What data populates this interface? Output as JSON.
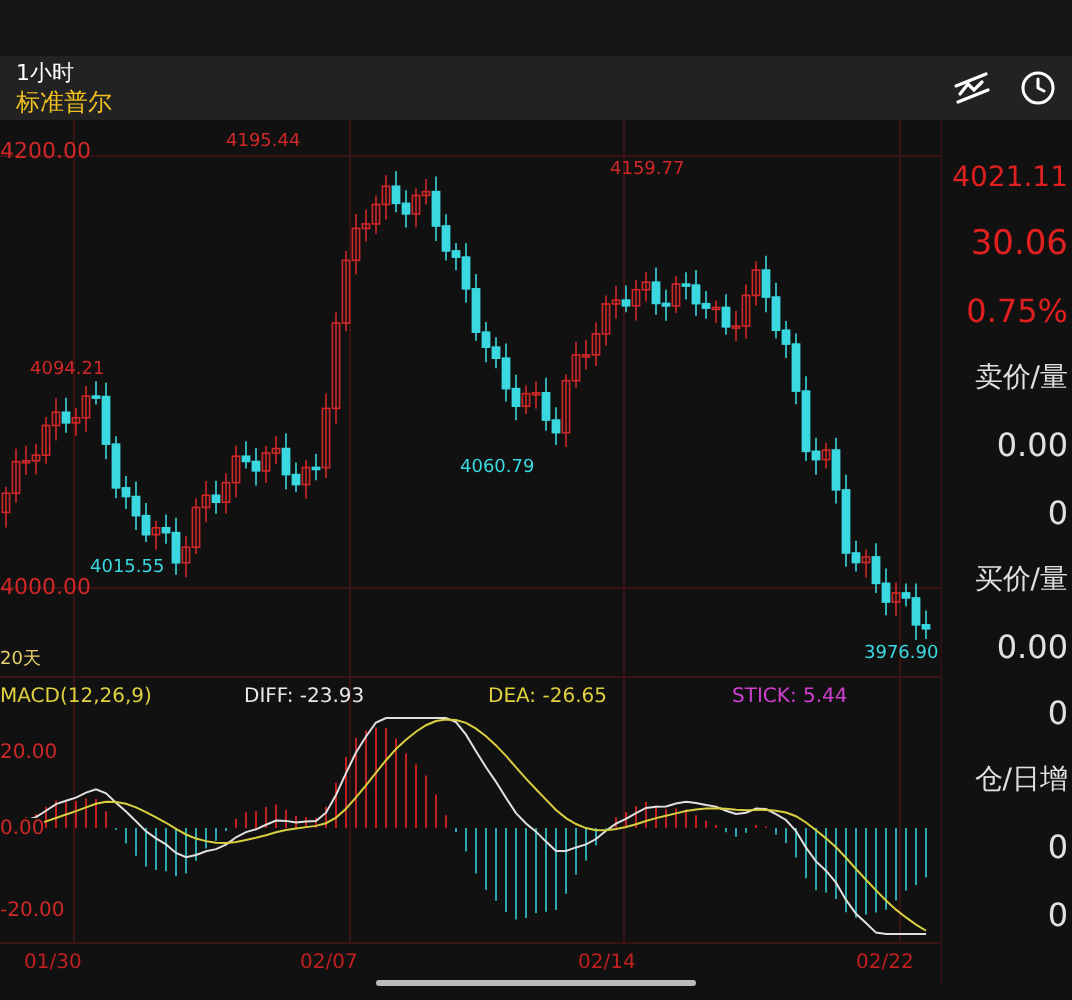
{
  "header": {
    "period": "1小时",
    "name": "标准普尔"
  },
  "price_axis": [
    "4200.00",
    "4000.00"
  ],
  "price_marks": [
    {
      "text": "4195.44",
      "kind": "high"
    },
    {
      "text": "4094.21",
      "kind": "high"
    },
    {
      "text": "4015.55",
      "kind": "low"
    },
    {
      "text": "4060.79",
      "kind": "low"
    },
    {
      "text": "4159.77",
      "kind": "high"
    },
    {
      "text": "3976.90",
      "kind": "low"
    }
  ],
  "ma_label": "20天",
  "quote": {
    "price": "4021.11",
    "change": "30.06",
    "change_pct": "0.75%"
  },
  "sell": {
    "label": "卖价/量",
    "price": "0.00",
    "volume": "0"
  },
  "buy": {
    "label": "买价/量",
    "price": "0.00",
    "volume": "0"
  },
  "position": {
    "label": "仓/日增",
    "values": [
      "0",
      "0"
    ]
  },
  "macd": {
    "title": "MACD(12,26,9)",
    "diff": "DIFF: -23.93",
    "dea": "DEA: -26.65",
    "stick": "STICK: 5.44",
    "axis": [
      "20.00",
      "0.00",
      "-20.00"
    ]
  },
  "dates": [
    "01/30",
    "02/07",
    "02/14",
    "02/22"
  ]
}
